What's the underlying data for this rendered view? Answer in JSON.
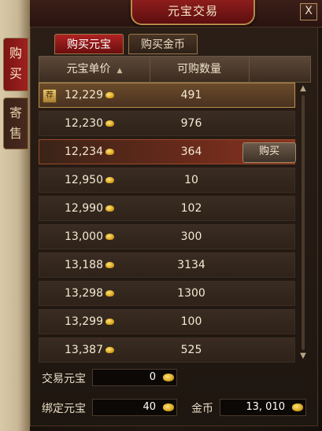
{
  "window": {
    "title": "元宝交易",
    "close_label": "X"
  },
  "side_tabs": [
    {
      "chars": [
        "购",
        "买"
      ],
      "active": true
    },
    {
      "chars": [
        "寄",
        "售"
      ],
      "active": false
    }
  ],
  "top_tabs": [
    {
      "label": "购买元宝",
      "active": true
    },
    {
      "label": "购买金币",
      "active": false
    }
  ],
  "table": {
    "headers": {
      "price": "元宝单价",
      "quantity": "可购数量"
    },
    "sort_icon": "sort-up-icon",
    "buy_label": "购买",
    "recommend_badge": "荐",
    "rows": [
      {
        "price": "12,229",
        "quantity": "491",
        "recommended": true
      },
      {
        "price": "12,230",
        "quantity": "976"
      },
      {
        "price": "12,234",
        "quantity": "364",
        "hover": true
      },
      {
        "price": "12,950",
        "quantity": "10"
      },
      {
        "price": "12,990",
        "quantity": "102"
      },
      {
        "price": "13,000",
        "quantity": "300"
      },
      {
        "price": "13,188",
        "quantity": "3134"
      },
      {
        "price": "13,298",
        "quantity": "1300"
      },
      {
        "price": "13,299",
        "quantity": "100"
      },
      {
        "price": "13,387",
        "quantity": "525"
      }
    ]
  },
  "footer": {
    "trade_yuanbao": {
      "label": "交易元宝",
      "value": "0"
    },
    "bound_yuanbao": {
      "label": "绑定元宝",
      "value": "40"
    },
    "gold": {
      "label": "金币",
      "value": "13, 010"
    }
  },
  "colors": {
    "accent_red": "#8e1d1d",
    "gold": "#d9a520",
    "text": "#e8dcc4"
  }
}
